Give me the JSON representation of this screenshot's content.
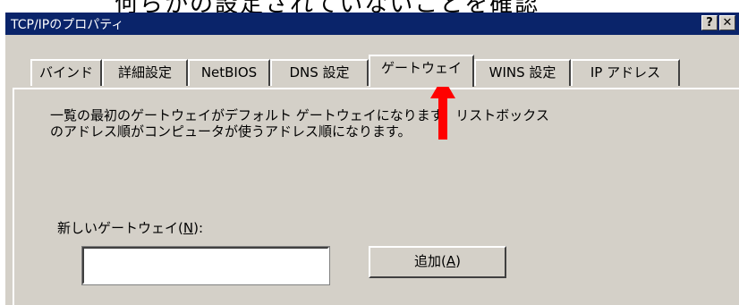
{
  "caption": "何らかの設定されていないことを確認",
  "window": {
    "title": "TCP/IPのプロパティ",
    "help_button": "?",
    "close_button": "✕"
  },
  "tabs": [
    {
      "label": "バインド",
      "active": false
    },
    {
      "label": "詳細設定",
      "active": false
    },
    {
      "label": "NetBIOS",
      "active": false
    },
    {
      "label": "DNS 設定",
      "active": false
    },
    {
      "label": "ゲートウェイ",
      "active": true
    },
    {
      "label": "WINS 設定",
      "active": false
    },
    {
      "label": "IP アドレス",
      "active": false
    }
  ],
  "description": {
    "line1": "一覧の最初のゲートウェイがデフォルト ゲートウェイになります。リストボックス",
    "line2": "のアドレス順がコンピュータが使うアドレス順になります。"
  },
  "gateway": {
    "label_prefix": "新しいゲートウェイ(",
    "label_key": "N",
    "label_suffix": "):",
    "ip_value": ""
  },
  "add_button": {
    "prefix": "追加(",
    "key": "A",
    "suffix": ")"
  },
  "annotation": {
    "arrow_color": "#ff0000",
    "icon": "up-arrow-icon"
  }
}
